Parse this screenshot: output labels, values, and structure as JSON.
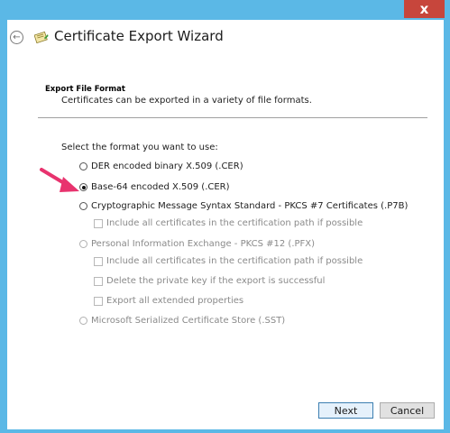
{
  "window": {
    "close_symbol": "x",
    "title": "Certificate Export Wizard",
    "icons": {
      "back": "back-arrow-icon",
      "app": "certificate-icon"
    }
  },
  "section": {
    "title": "Export File Format",
    "description": "Certificates can be exported in a variety of file formats."
  },
  "prompt": "Select the format you want to use:",
  "options": [
    {
      "label": "DER encoded binary X.509 (.CER)",
      "selected": false,
      "enabled": true
    },
    {
      "label": "Base-64 encoded X.509 (.CER)",
      "selected": true,
      "enabled": true
    },
    {
      "label": "Cryptographic Message Syntax Standard - PKCS #7 Certificates (.P7B)",
      "selected": false,
      "enabled": true
    },
    {
      "label": "Personal Information Exchange - PKCS #12 (.PFX)",
      "selected": false,
      "enabled": false
    },
    {
      "label": "Microsoft Serialized Certificate Store (.SST)",
      "selected": false,
      "enabled": false
    }
  ],
  "checkboxes": {
    "p7b_include_all": {
      "label": "Include all certificates in the certification path if possible",
      "checked": false,
      "enabled": false
    },
    "pfx_include_all": {
      "label": "Include all certificates in the certification path if possible",
      "checked": false,
      "enabled": false
    },
    "pfx_delete_key": {
      "label": "Delete the private key if the export is successful",
      "checked": false,
      "enabled": false
    },
    "pfx_export_props": {
      "label": "Export all extended properties",
      "checked": false,
      "enabled": false
    }
  },
  "buttons": {
    "next": "Next",
    "cancel": "Cancel"
  },
  "colors": {
    "arrow": "#e8336e",
    "window_frame": "#5bb8e6",
    "close_button": "#c7463c"
  }
}
